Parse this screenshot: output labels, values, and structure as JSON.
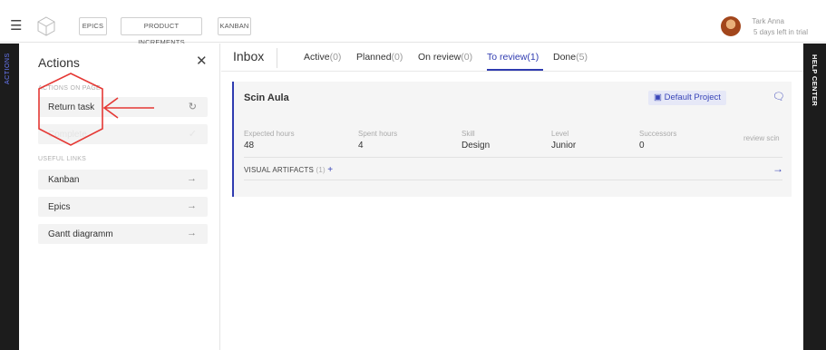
{
  "topbar": {
    "tags": [
      "EPICS",
      "PRODUCT INCREMENTS",
      "KANBAN"
    ],
    "user": {
      "name": "Tark Anna",
      "subtitle": "5 days left in trial"
    }
  },
  "left_strip": {
    "label": "ACTIONS"
  },
  "right_strip": {
    "label": "HELP CENTER"
  },
  "actions": {
    "title": "Actions",
    "section_actions": "ACTIONS ON PAGE",
    "items": [
      {
        "label": "Return task",
        "icon": "undo-icon"
      },
      {
        "label": "Complete",
        "icon": "check-icon"
      }
    ],
    "section_links": "USEFUL LINKS",
    "links": [
      {
        "label": "Kanban"
      },
      {
        "label": "Epics"
      },
      {
        "label": "Gantt diagramm"
      }
    ]
  },
  "inbox": {
    "title": "Inbox",
    "tabs": [
      {
        "label": "Active",
        "count": "(0)"
      },
      {
        "label": "Planned",
        "count": "(0)"
      },
      {
        "label": "On review",
        "count": "(0)"
      },
      {
        "label": "To review",
        "count": "(1)"
      },
      {
        "label": "Done",
        "count": "(5)"
      }
    ]
  },
  "task": {
    "title": "Scin Aula",
    "project": "Default Project",
    "fields": [
      {
        "label": "Expected hours",
        "value": "48"
      },
      {
        "label": "Spent hours",
        "value": "4"
      },
      {
        "label": "Skill",
        "value": "Design"
      },
      {
        "label": "Level",
        "value": "Junior"
      },
      {
        "label": "Successors",
        "value": "0"
      }
    ],
    "review_text": "review scin",
    "visual_artifacts": {
      "label": "VISUAL ARTIFACTS",
      "count": "(1)"
    }
  },
  "colors": {
    "accent": "#2f3bb0",
    "annotation": "#e53935",
    "sidebar": "#1c1c1c"
  }
}
